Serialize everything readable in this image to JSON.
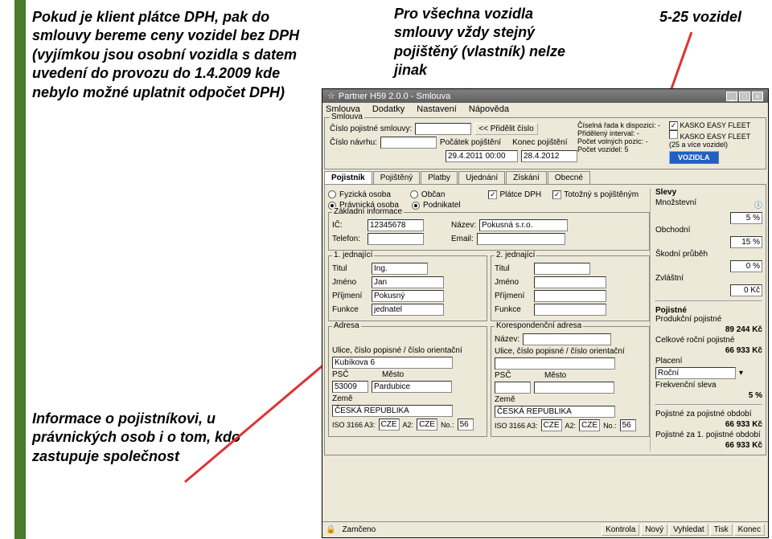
{
  "notes": {
    "n1": "Pokud je klient plátce DPH, pak do smlouvy bereme ceny vozidel bez DPH (vyjímkou jsou osobní vozidla s datem uvedení do provozu do 1.4.2009 kde nebylo možné uplatnit odpočet DPH)",
    "n2": "Pro všechna vozidla smlouvy vždy stejný pojištěný (vlastník) nelze jinak",
    "n3": "5-25 vozidel",
    "n4": "Informace o pojistníkovi, u právnických osob i o tom, kdo zastupuje společnost"
  },
  "title": "Partner H59 2.0.0 - Smlouva",
  "menu": {
    "m1": "Smlouva",
    "m2": "Dodatky",
    "m3": "Nastavení",
    "m4": "Nápověda"
  },
  "smlouva": {
    "panel_title": "Smlouva",
    "lbl_cislo_sml": "Číslo pojistné smlouvy:",
    "btn_pridelit": "<< Přidělit číslo",
    "lbl_cislo_navrhu": "Číslo návrhu:",
    "lbl_pocatek": "Počátek pojištění",
    "lbl_konec": "Konec pojištění",
    "val_pocatek": "29.4.2011 00:00",
    "val_konec": "28.4.2012",
    "right_lbl1": "Číselná řada k dispozici: -",
    "right_lbl2": "Přidělený interval: -",
    "right_lbl3": "Počet volných pozic: -",
    "right_lbl4": "Počet vozidel:",
    "right_val4": "5",
    "chk1": "KASKO EASY FLEET",
    "chk2": "KASKO EASY FLEET (25 a více vozidel)",
    "btn_vozidla": "VOZIDLA"
  },
  "tabs": {
    "t1": "Pojistník",
    "t2": "Pojištěný",
    "t3": "Platby",
    "t4": "Ujednání",
    "t5": "Získání",
    "t6": "Obecné"
  },
  "form": {
    "fyzicka": "Fyzická osoba",
    "pravnicka": "Právnická osoba",
    "obcan": "Občan",
    "podnikatel": "Podnikatel",
    "platce": "Plátce DPH",
    "totozny": "Totožný s pojištěným",
    "zakladni": "Základní informace",
    "ic": "IČ:",
    "ic_v": "12345678",
    "nazev": "Název:",
    "nazev_v": "Pokusná s.r.o.",
    "telefon": "Telefon:",
    "email": "Email:",
    "jedna1": "1. jednající",
    "jedna2": "2. jednající",
    "titul": "Titul",
    "titul_v": "Ing.",
    "jmeno": "Jméno",
    "jmeno_v": "Jan",
    "prijmeni": "Příjmení",
    "prijmeni_v": "Pokusný",
    "funkce": "Funkce",
    "funkce_v": "jednatel",
    "adresa": "Adresa",
    "koresp": "Korespondenční adresa",
    "nazev2": "Název:",
    "ulice": "Ulice, číslo popisné / číslo orientační",
    "ulice_v": "Kubíkova 6",
    "psc": "PSČ",
    "psc_v": "53009",
    "mesto": "Město",
    "mesto_v": "Pardubice",
    "zeme": "Země",
    "zeme_v": "ČESKÁ REPUBLIKA",
    "iso": "ISO 3166  A3:",
    "a3": "CZE",
    "a2l": "A2:",
    "a2": "CZE",
    "nol": "No.:",
    "no": "56"
  },
  "right": {
    "slevy": "Slevy",
    "mnozstevni": "Množstevní",
    "info": "ⓘ",
    "pct5": "5 %",
    "obchodni": "Obchodní",
    "pct15": "15 %",
    "skodni": "Škodní průběh",
    "pct0": "0 %",
    "zvlastni": "Zvláštní",
    "kc0": "0 Kč",
    "pojistne": "Pojistné",
    "produkcni": "Produkční pojistné",
    "v1": "89 244 Kč",
    "celkove": "Celkové roční pojistné",
    "v2": "66 933 Kč",
    "placeni": "Placení",
    "rocni": "Roční",
    "frekv": "Frekvenční sleva",
    "pct5b": "5 %",
    "zaobd": "Pojistné za pojistné období",
    "v3": "66 933 Kč",
    "za1": "Pojistné za 1. pojistné období",
    "v4": "66 933 Kč"
  },
  "status": {
    "zamceno": "Zamčeno",
    "kontrola": "Kontrola",
    "novy": "Nový",
    "vyhledat": "Vyhledat",
    "tisk": "Tisk",
    "konec": "Konec"
  }
}
